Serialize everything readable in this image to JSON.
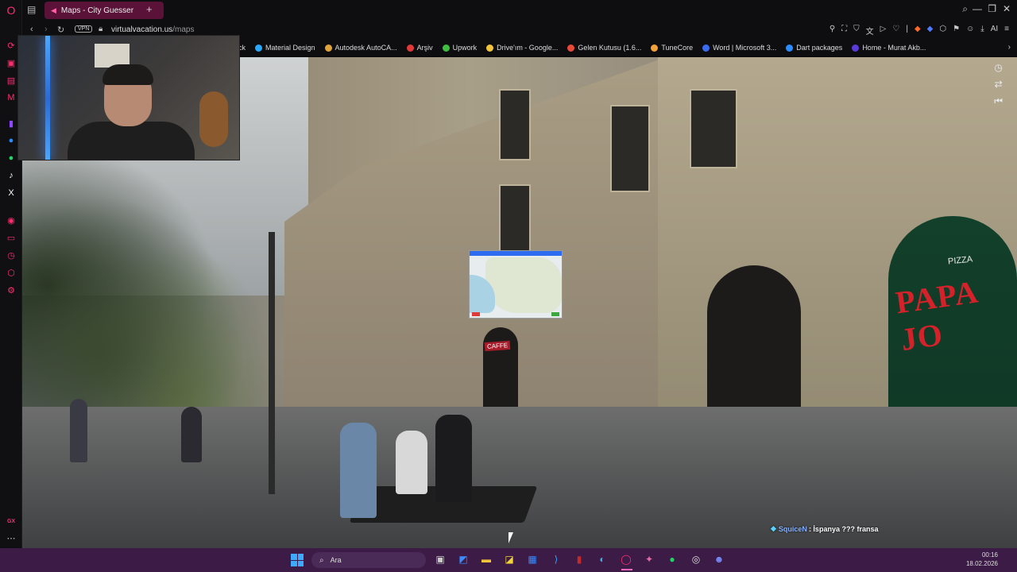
{
  "browser": {
    "tab_title": "Maps - City Guesser",
    "tab_close": "✕",
    "new_tab": "+",
    "vpn_label": "VPN",
    "url_host": "virtualvacation.us",
    "url_path": "/maps",
    "ai_label": "AI"
  },
  "bookmarks": [
    {
      "label": "ck",
      "color": "#cccccc"
    },
    {
      "label": "Material Design",
      "color": "#2aa7ff"
    },
    {
      "label": "Autodesk AutoCA...",
      "color": "#e0a43a"
    },
    {
      "label": "Arşiv",
      "color": "#e23a3a"
    },
    {
      "label": "Upwork",
      "color": "#3fbf3f"
    },
    {
      "label": "Drive'ım - Google...",
      "color": "#f2c43a"
    },
    {
      "label": "Gelen Kutusu (1.6...",
      "color": "#e84a3a"
    },
    {
      "label": "TuneCore",
      "color": "#f3a13a"
    },
    {
      "label": "Word | Microsoft 3...",
      "color": "#3a6cf2"
    },
    {
      "label": "Dart packages",
      "color": "#2a8cff"
    },
    {
      "label": "Home - Murat Akb...",
      "color": "#5a3ad8"
    }
  ],
  "street_view": {
    "sign_brand": "PAPA JO",
    "sign_top": "PIZZA",
    "shop_sign": "CAFFE"
  },
  "chat": {
    "user": "SquiceN",
    "message": ": İspanya ??? fransa"
  },
  "taskbar": {
    "search_placeholder": "Ara",
    "time": "00:16",
    "date": "18.02.2026"
  },
  "sidebar_bottom": "GX",
  "colors": {
    "accent": "#ff2d6f",
    "taskbar": "#3c1c47",
    "tab_active": "#5a1238"
  }
}
